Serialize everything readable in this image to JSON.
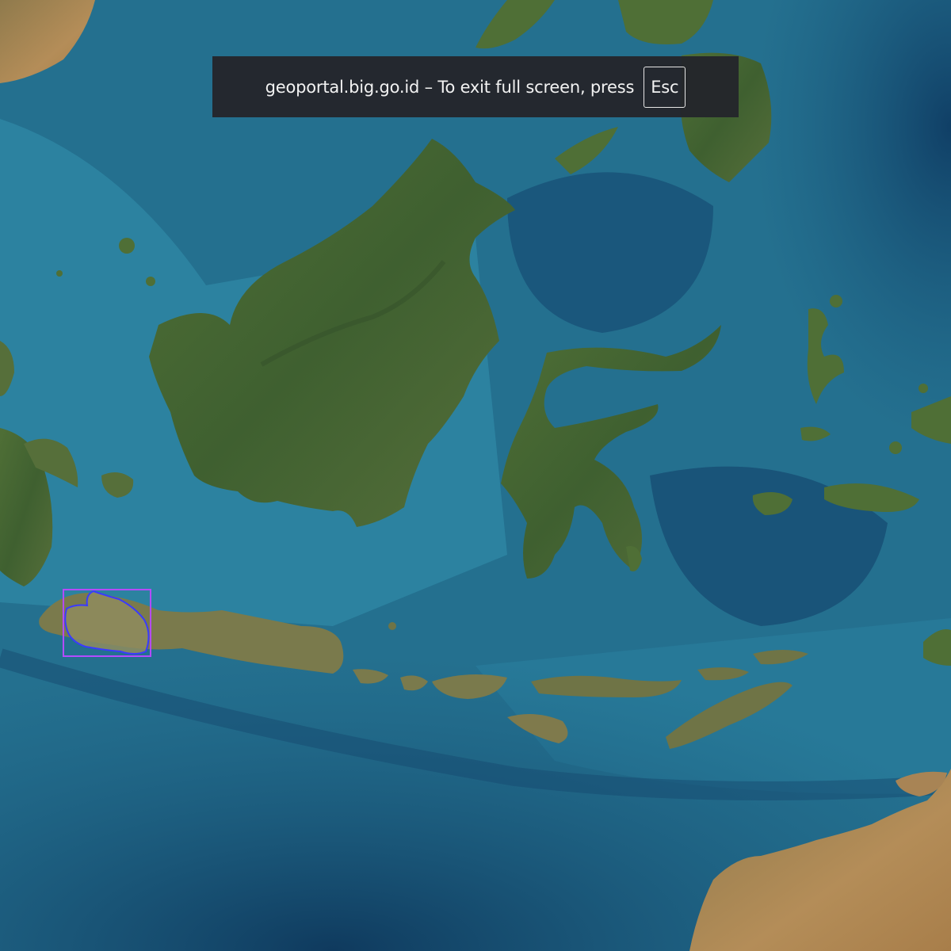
{
  "fullscreen_notice": {
    "message": "geoportal.big.go.id – To exit full screen, press",
    "key_label": "Esc"
  },
  "map": {
    "basemap": "satellite-imagery",
    "highlight": {
      "region_outline_color": "#3a3aff",
      "bbox_color": "#b44bff"
    }
  },
  "colors": {
    "ocean_shallow": "#2a7d9c",
    "ocean_deep": "#14456a",
    "land_forest": "#4a6a32",
    "land_arid": "#b08a55",
    "notice_bg": "#24262b"
  }
}
